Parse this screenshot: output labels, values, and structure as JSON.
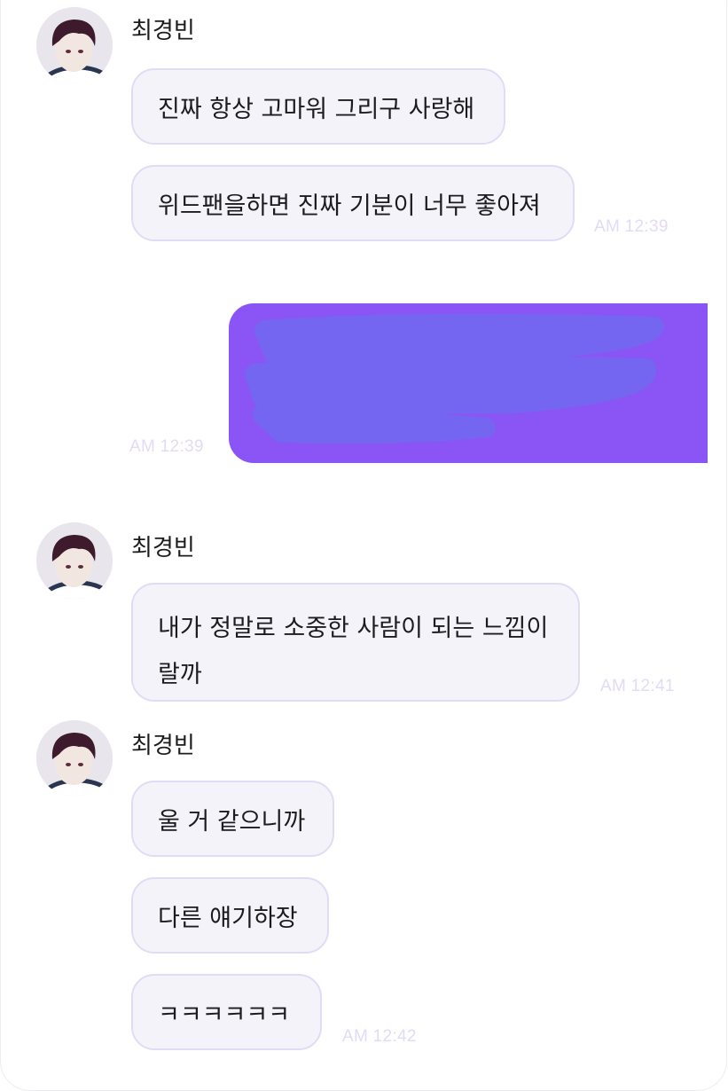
{
  "colors": {
    "received_bubble_bg": "#f4f3fa",
    "received_bubble_border": "#e3dbf5",
    "sent_bubble_bg": "#8b55f6",
    "redaction_scribble": "#7466f0",
    "timestamp": "#e3dbf5",
    "text": "#1c1c1e"
  },
  "conversation": {
    "groups": [
      {
        "sender": "최경빈",
        "messages": [
          "진짜 항상 고마워 그리구 사랑해",
          "위드팬을하면 진짜 기분이 너무 좋아져"
        ],
        "time": "AM 12:39"
      },
      {
        "outgoing": true,
        "redacted": true,
        "time": "AM 12:39"
      },
      {
        "sender": "최경빈",
        "messages": [
          "내가 정말로 소중한 사람이 되는 느낌이 랄까"
        ],
        "time": "AM 12:41"
      },
      {
        "sender": "최경빈",
        "messages": [
          "울 거 같으니까",
          "다른 얘기하장",
          "ㅋㅋㅋㅋㅋㅋ"
        ],
        "time": "AM 12:42"
      }
    ]
  }
}
